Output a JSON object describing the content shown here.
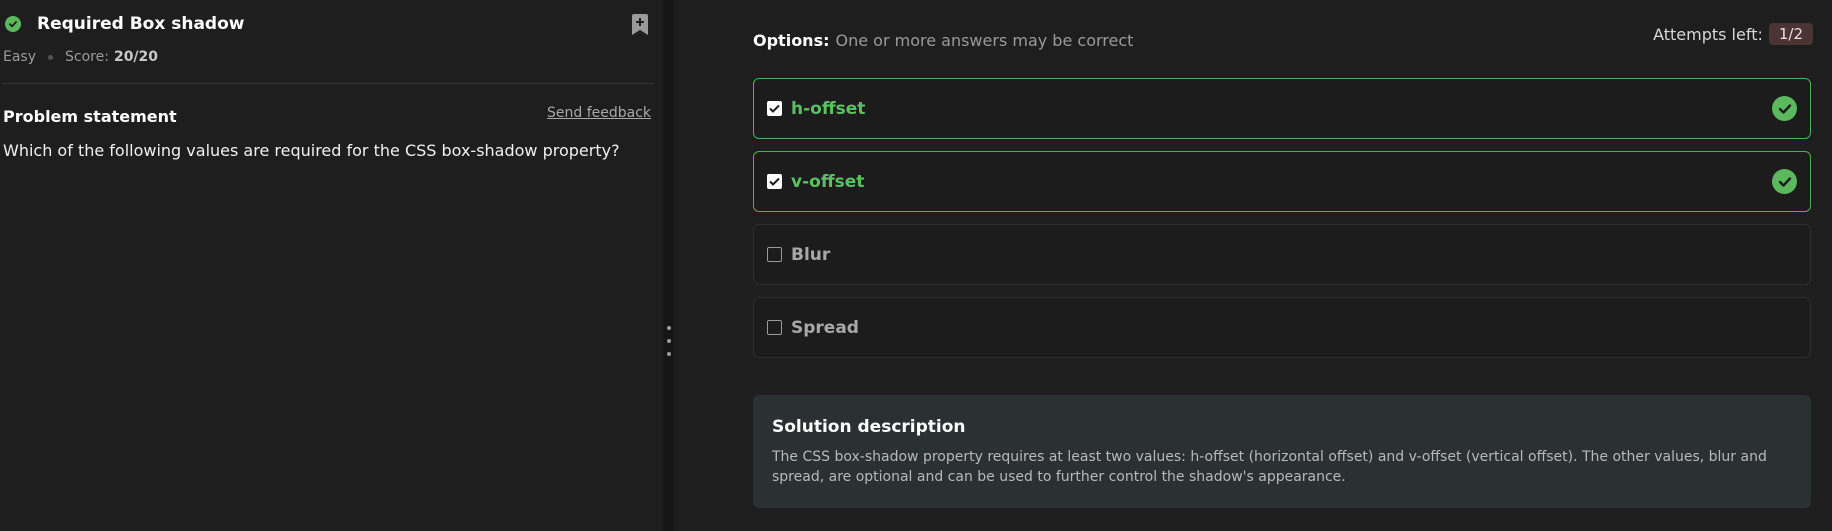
{
  "problem": {
    "title": "Required Box shadow",
    "difficulty": "Easy",
    "score_label": "Score:",
    "score_value": "20/20",
    "statement_heading": "Problem statement",
    "feedback_link": "Send feedback",
    "question": "Which of the following values are required for the CSS box-shadow property?"
  },
  "options_panel": {
    "label": "Options:",
    "hint": "One or more answers may be correct",
    "attempts_label": "Attempts left:",
    "attempts_value": "1/2",
    "options": [
      {
        "label": "h-offset",
        "checked": true,
        "correct": true
      },
      {
        "label": "v-offset",
        "checked": true,
        "correct": true
      },
      {
        "label": "Blur",
        "checked": false,
        "correct": false
      },
      {
        "label": "Spread",
        "checked": false,
        "correct": false
      }
    ]
  },
  "solution": {
    "heading": "Solution description",
    "text": "The CSS box-shadow property requires at least two values: h-offset (horizontal offset) and v-offset (vertical offset). The other values, blur and spread, are optional and can be used to further control the shadow's appearance."
  },
  "colors": {
    "success": "#5cb85c",
    "attempts_badge": "#4a3434",
    "solution_bg": "#2b3133"
  },
  "icons": {
    "status": "check-circle-icon",
    "bookmark": "bookmark-add-icon",
    "resize": "drag-handle-icon"
  }
}
